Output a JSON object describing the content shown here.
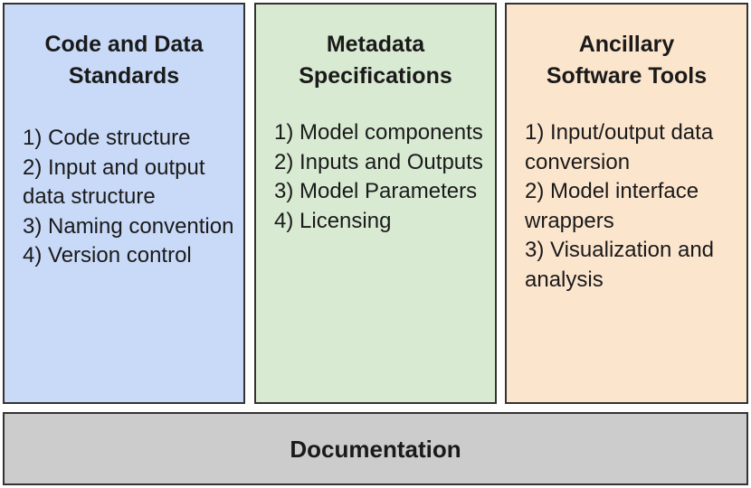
{
  "panels": [
    {
      "title_lines": [
        "Code and Data",
        "Standards"
      ],
      "items": [
        "1) Code structure",
        "2) Input and output data structure",
        "3) Naming convention",
        "4) Version control"
      ],
      "color": "#c9daf8"
    },
    {
      "title_lines": [
        "Metadata",
        "Specifications"
      ],
      "items": [
        "1) Model components",
        "2) Inputs and Outputs",
        "3) Model Parameters",
        "4) Licensing"
      ],
      "color": "#d9ead3"
    },
    {
      "title_lines": [
        "Ancillary",
        "Software Tools"
      ],
      "items": [
        "1) Input/output data conversion",
        "2) Model interface wrappers",
        "3) Visualization and analysis"
      ],
      "color": "#fce5cd"
    }
  ],
  "foundation": {
    "title": "Documentation",
    "color": "#cccccc"
  },
  "border_color": "#333333"
}
